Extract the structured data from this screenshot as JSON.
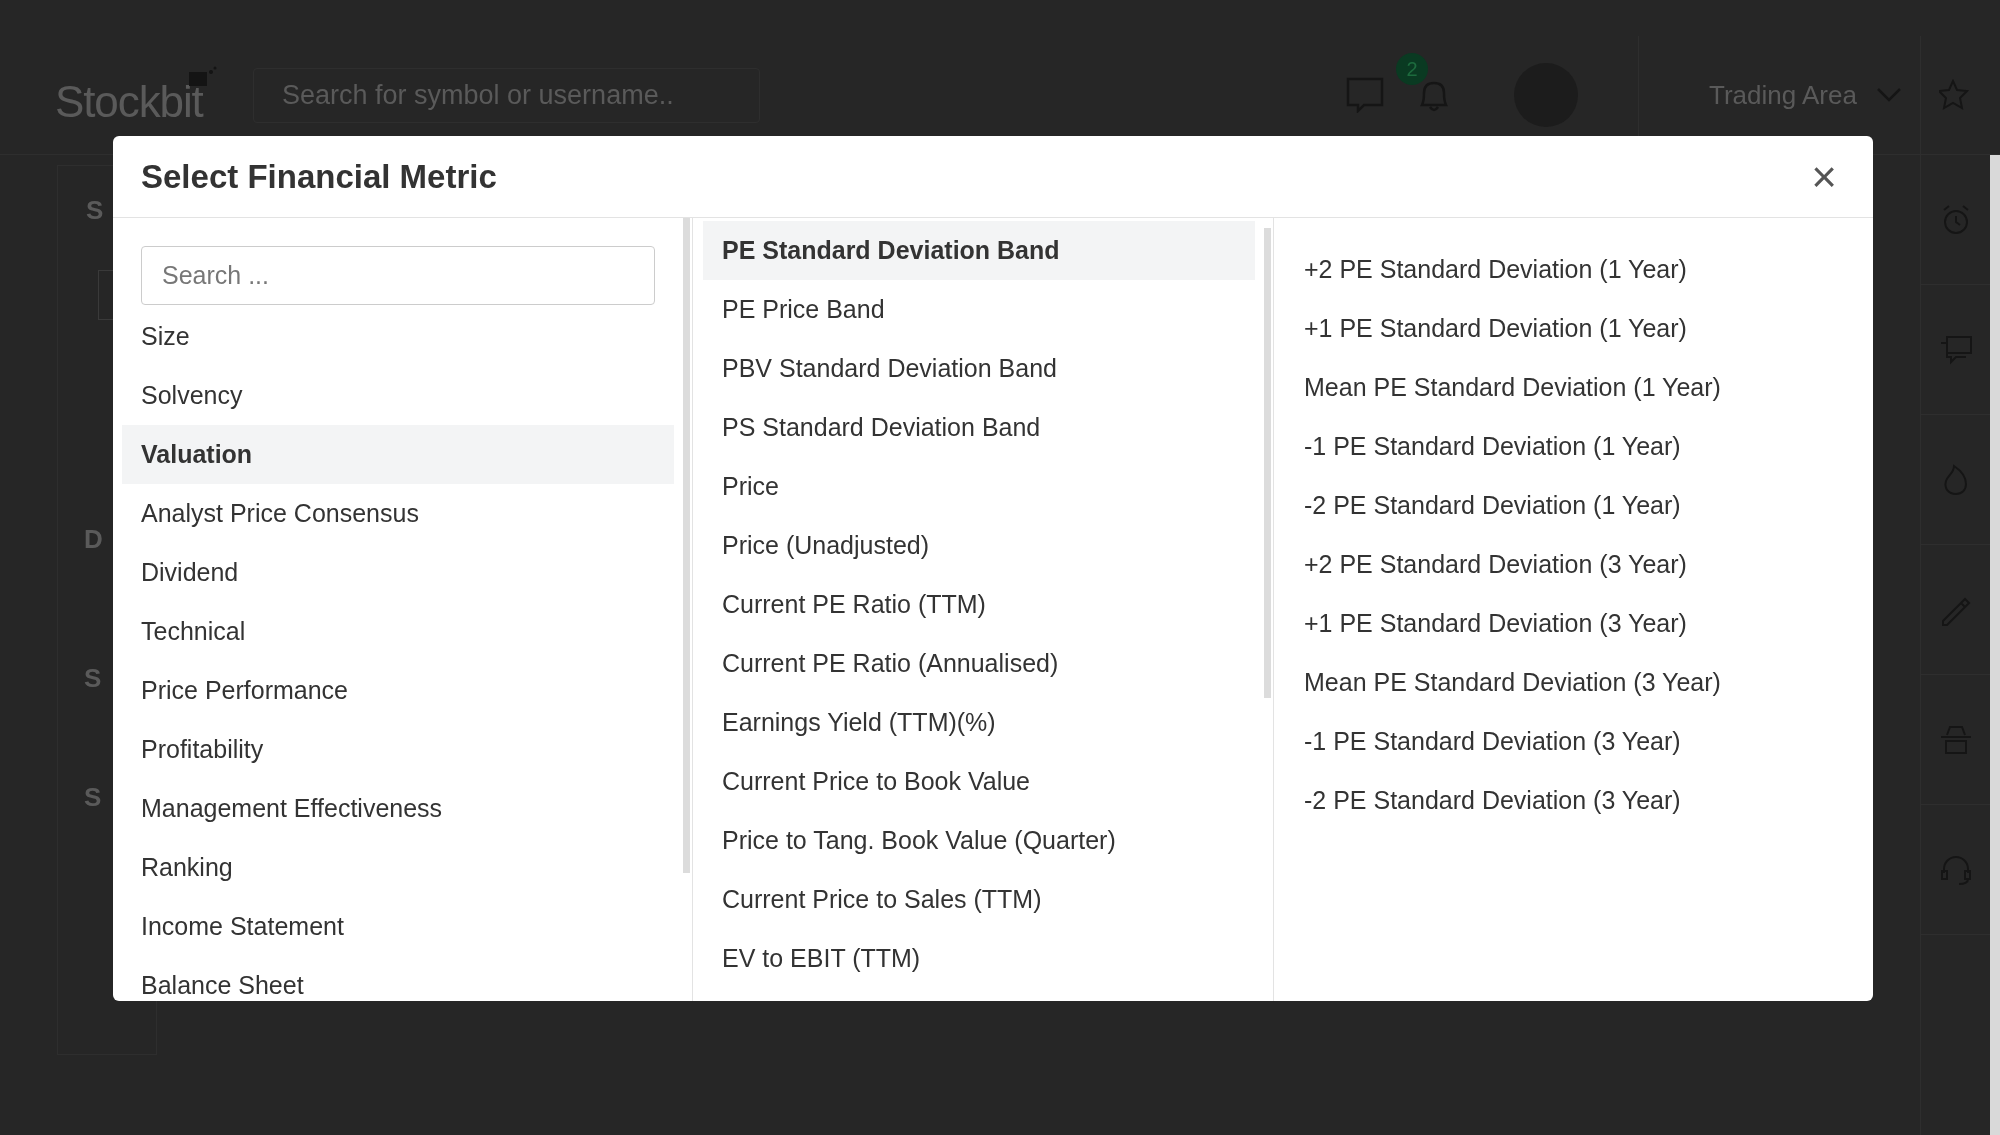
{
  "app_header": {
    "logo": "Stockbit",
    "search": {
      "placeholder": "Search for symbol or username.."
    },
    "notification_count": "2",
    "menu": "Trading Area"
  },
  "background_fragments": [
    "S",
    "D",
    "S",
    "S"
  ],
  "modal": {
    "title": "Select Financial Metric",
    "close": "×",
    "search": {
      "placeholder": "Search ..."
    },
    "categories": [
      {
        "label": "Size",
        "selected": false
      },
      {
        "label": "Solvency",
        "selected": false
      },
      {
        "label": "Valuation",
        "selected": true
      },
      {
        "label": "Analyst Price Consensus",
        "selected": false
      },
      {
        "label": "Dividend",
        "selected": false
      },
      {
        "label": "Technical",
        "selected": false
      },
      {
        "label": "Price Performance",
        "selected": false
      },
      {
        "label": "Profitability",
        "selected": false
      },
      {
        "label": "Management Effectiveness",
        "selected": false
      },
      {
        "label": "Ranking",
        "selected": false
      },
      {
        "label": "Income Statement",
        "selected": false
      },
      {
        "label": "Balance Sheet",
        "selected": false
      }
    ],
    "metrics": [
      {
        "label": "PE Standard Deviation Band",
        "selected": true
      },
      {
        "label": "PE Price Band",
        "selected": false
      },
      {
        "label": "PBV Standard Deviation Band",
        "selected": false
      },
      {
        "label": "PS Standard Deviation Band",
        "selected": false
      },
      {
        "label": "Price",
        "selected": false
      },
      {
        "label": "Price (Unadjusted)",
        "selected": false
      },
      {
        "label": "Current PE Ratio (TTM)",
        "selected": false
      },
      {
        "label": "Current PE Ratio (Annualised)",
        "selected": false
      },
      {
        "label": "Earnings Yield (TTM)(%)",
        "selected": false
      },
      {
        "label": "Current Price to Book Value",
        "selected": false
      },
      {
        "label": "Price to Tang. Book Value (Quarter)",
        "selected": false
      },
      {
        "label": "Current Price to Sales (TTM)",
        "selected": false
      },
      {
        "label": "EV to EBIT (TTM)",
        "selected": false
      }
    ],
    "series": [
      "+2 PE Standard Deviation (1 Year)",
      "+1 PE Standard Deviation (1 Year)",
      "Mean PE Standard Deviation (1 Year)",
      "-1 PE Standard Deviation (1 Year)",
      "-2 PE Standard Deviation (1 Year)",
      "+2 PE Standard Deviation (3 Year)",
      "+1 PE Standard Deviation (3 Year)",
      "Mean PE Standard Deviation (3 Year)",
      "-1 PE Standard Deviation (3 Year)",
      "-2 PE Standard Deviation (3 Year)"
    ]
  }
}
